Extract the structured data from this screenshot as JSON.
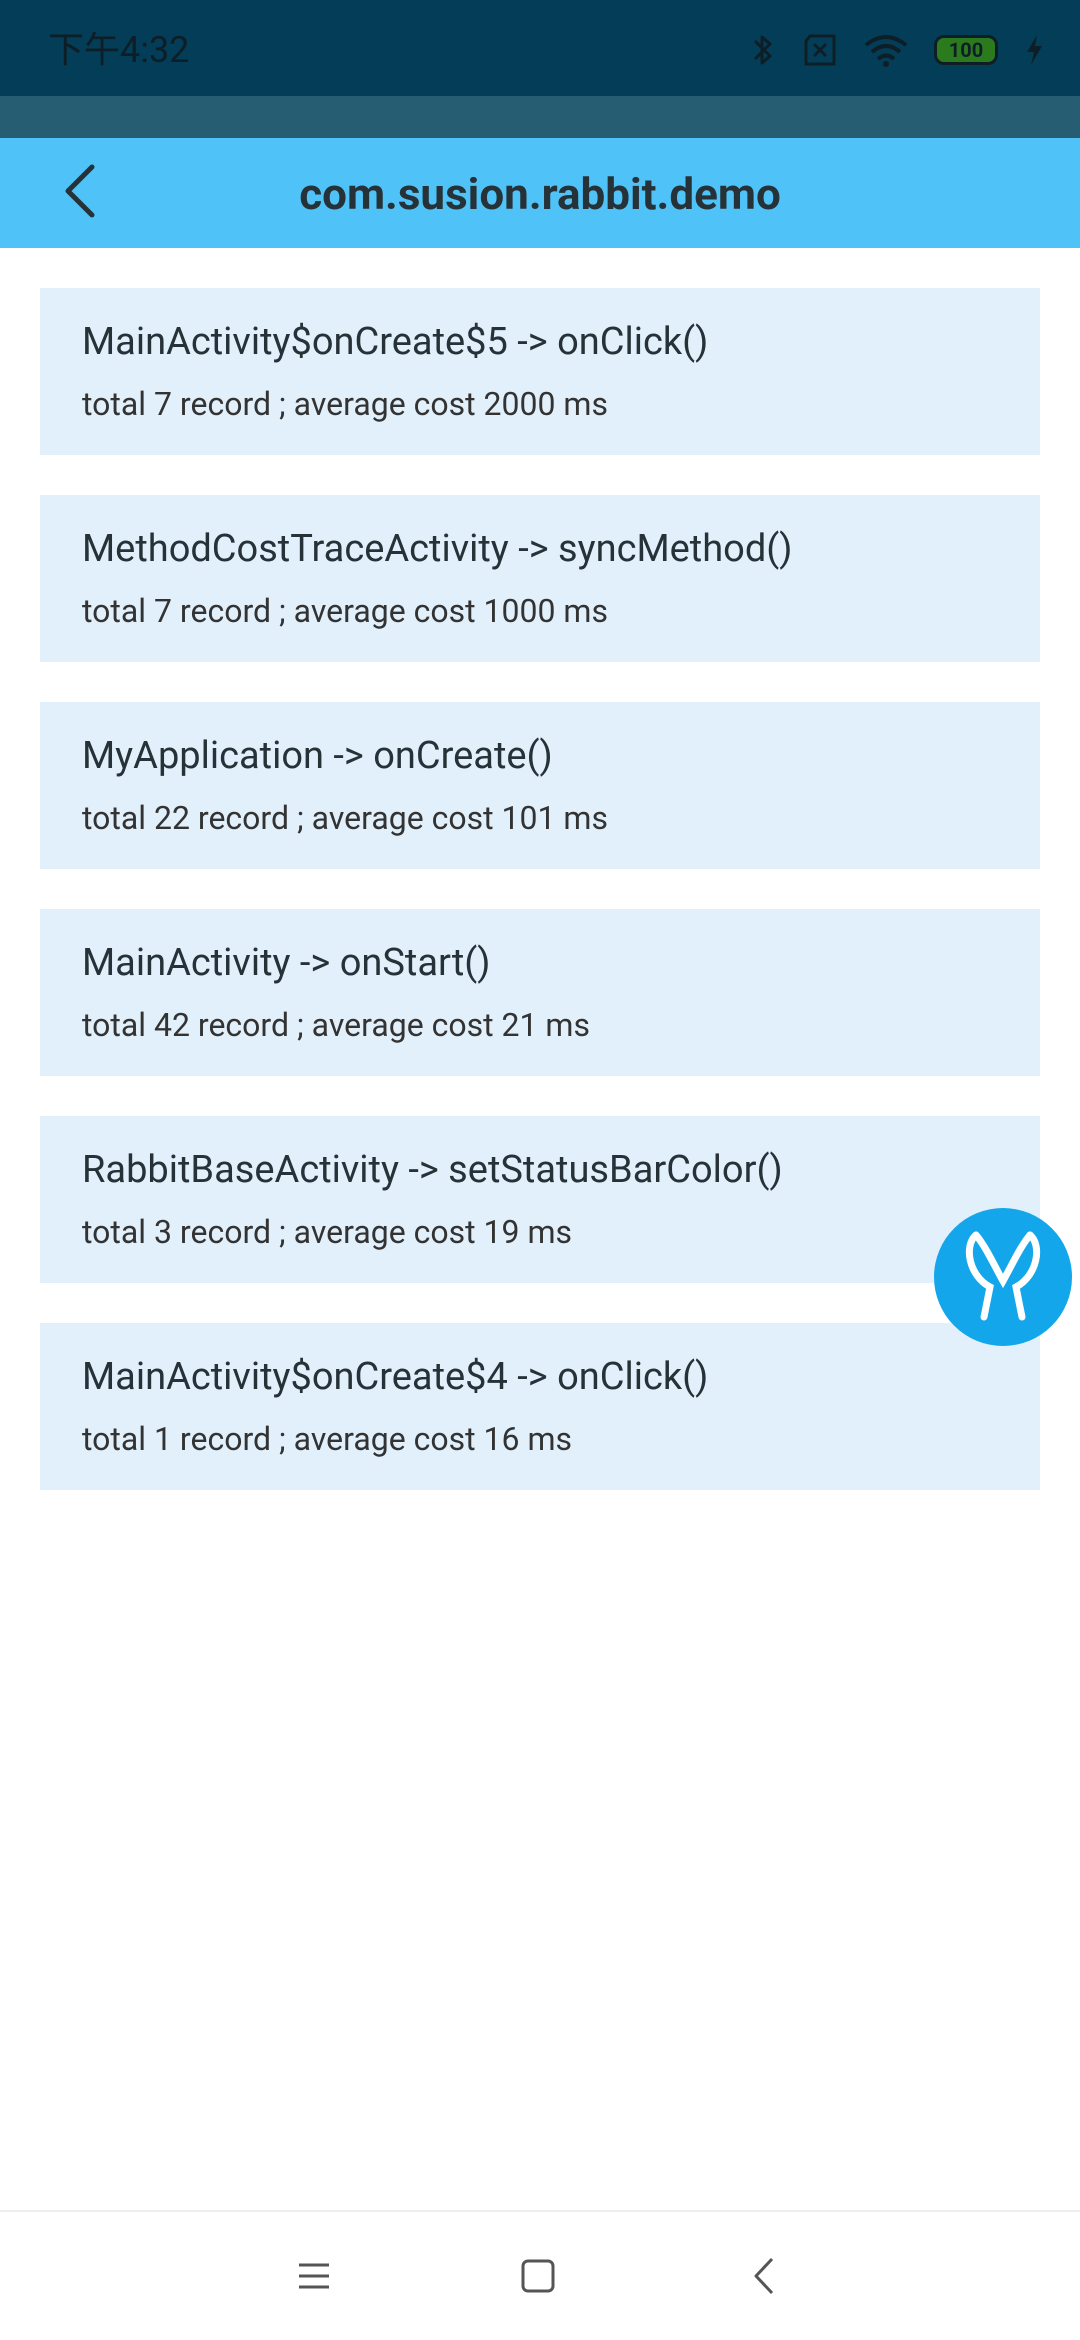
{
  "status_bar": {
    "time": "下午4:32",
    "battery_level": "100",
    "icons": [
      "bluetooth-icon",
      "sim-disabled-icon",
      "wifi-icon",
      "battery-icon",
      "charging-icon"
    ]
  },
  "toolbar": {
    "title": "com.susion.rabbit.demo",
    "back_icon": "chevron-left-icon",
    "background_color": "#4fc3f7"
  },
  "records": [
    {
      "method": "MainActivity$onCreate$5 -> onClick()",
      "summary": "total 7 record ; average cost 2000 ms"
    },
    {
      "method": "MethodCostTraceActivity -> syncMethod()",
      "summary": "total 7 record ; average cost 1000 ms"
    },
    {
      "method": "MyApplication -> onCreate()",
      "summary": "total 22 record ; average cost 101 ms"
    },
    {
      "method": "MainActivity -> onStart()",
      "summary": "total 42 record ; average cost 21 ms"
    },
    {
      "method": "RabbitBaseActivity -> setStatusBarColor()",
      "summary": "total 3 record ; average cost 19 ms"
    },
    {
      "method": "MainActivity$onCreate$4 -> onClick()",
      "summary": "total 1 record ; average cost 16 ms"
    }
  ],
  "fab": {
    "icon": "rabbit-logo-icon",
    "color": "#13a6ea"
  },
  "nav_bar": {
    "buttons": [
      "menu-icon",
      "home-icon",
      "back-icon"
    ]
  },
  "colors": {
    "item_background": "#e1f0fb",
    "status_bar": "#043d57"
  }
}
